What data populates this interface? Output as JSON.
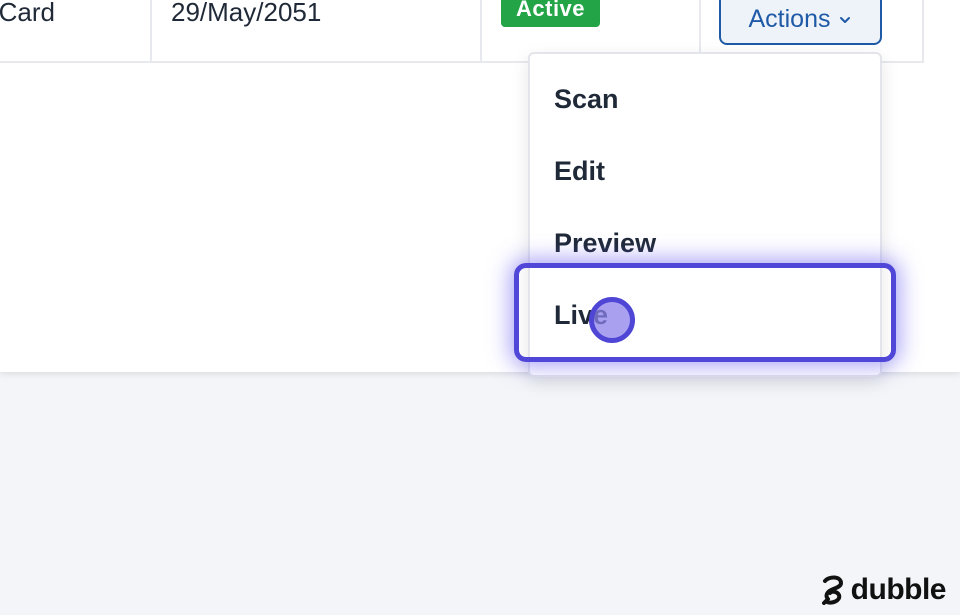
{
  "table": {
    "row": {
      "type_fragment": "Card",
      "date": "29/May/2051",
      "status": "Active",
      "actions_label": "Actions"
    }
  },
  "menu": {
    "items": [
      {
        "label": "Scan"
      },
      {
        "label": "Edit"
      },
      {
        "label": "Preview"
      },
      {
        "label": "Live"
      }
    ],
    "highlighted": "Live"
  },
  "branding": {
    "name": "dubble"
  },
  "colors": {
    "status_active": "#22a447",
    "action_blue": "#1e5aa6",
    "highlight": "#5046d8",
    "background": "#f3f5f8"
  },
  "icons": [
    "chevron-down-icon",
    "dubble-logo-icon"
  ]
}
